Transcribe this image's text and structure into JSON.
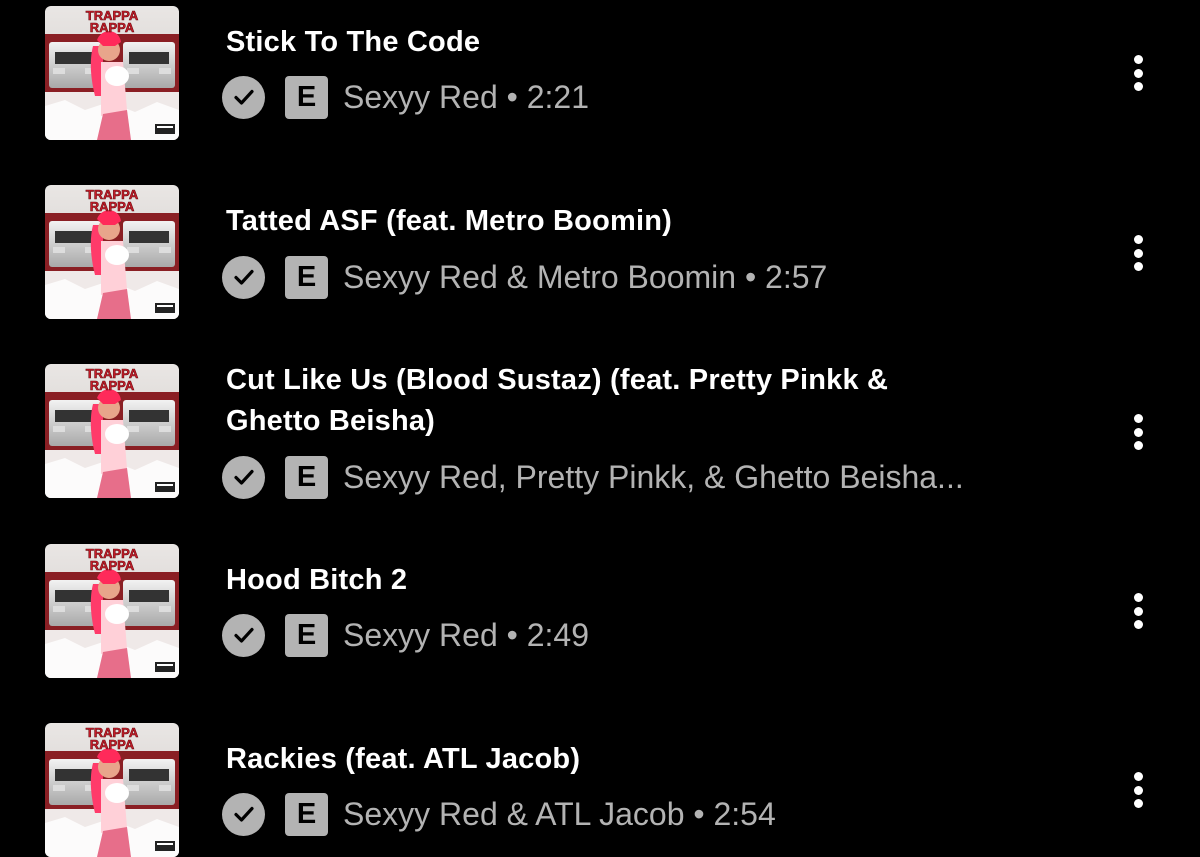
{
  "colors": {
    "background": "#000000",
    "title": "#ffffff",
    "secondary": "#b3b3b3"
  },
  "album_art": {
    "text_line1": "TRAPPA",
    "text_line2": "RAPPA"
  },
  "tracks": [
    {
      "title_lines": [
        "Stick To The Code"
      ],
      "check_icon": "check-circle-icon",
      "explicit_label": "E",
      "subtitle": "Sexyy Red • 2:21"
    },
    {
      "title_lines": [
        "Tatted ASF (feat. Metro Boomin)"
      ],
      "check_icon": "check-circle-icon",
      "explicit_label": "E",
      "subtitle": "Sexyy Red & Metro Boomin • 2:57"
    },
    {
      "title_lines": [
        "Cut Like Us (Blood Sustaz) (feat. Pretty Pinkk &",
        "Ghetto Beisha)"
      ],
      "check_icon": "check-circle-icon",
      "explicit_label": "E",
      "subtitle": "Sexyy Red, Pretty Pinkk, & Ghetto Beisha..."
    },
    {
      "title_lines": [
        "Hood Bitch 2"
      ],
      "check_icon": "check-circle-icon",
      "explicit_label": "E",
      "subtitle": "Sexyy Red • 2:49"
    },
    {
      "title_lines": [
        "Rackies (feat. ATL Jacob)"
      ],
      "check_icon": "check-circle-icon",
      "explicit_label": "E",
      "subtitle": "Sexyy Red & ATL Jacob • 2:54"
    }
  ]
}
